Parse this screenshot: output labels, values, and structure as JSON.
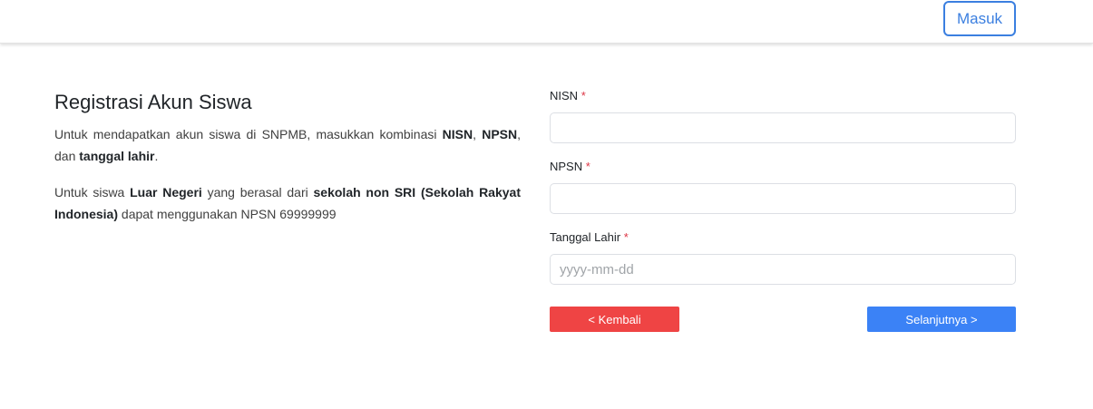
{
  "navbar": {
    "login_label": "Masuk"
  },
  "intro": {
    "title": "Registrasi Akun Siswa",
    "para1": {
      "t1": "Untuk mendapatkan akun siswa di SNPMB, masukkan kombinasi ",
      "b1": "NISN",
      "t2": ", ",
      "b2": "NPSN",
      "t3": ", dan ",
      "b3": "tanggal lahir",
      "t4": "."
    },
    "para2": {
      "t1": "Untuk siswa ",
      "b1": "Luar Negeri",
      "t2": " yang berasal dari ",
      "b2": "sekolah non SRI (Sekolah Rakyat Indonesia)",
      "t3": " dapat menggunakan NPSN 69999999"
    }
  },
  "form": {
    "nisn": {
      "label": "NISN",
      "required_mark": "*",
      "value": "",
      "placeholder": ""
    },
    "npsn": {
      "label": "NPSN",
      "required_mark": "*",
      "value": "",
      "placeholder": ""
    },
    "dob": {
      "label": "Tanggal Lahir",
      "required_mark": "*",
      "value": "",
      "placeholder": "yyyy-mm-dd"
    }
  },
  "actions": {
    "back_label": "< Kembali",
    "next_label": "Selanjutnya >"
  },
  "colors": {
    "accent": "#3b7fe0",
    "back": "#ef4444",
    "next": "#3b82f6",
    "required": "#dc3545"
  }
}
